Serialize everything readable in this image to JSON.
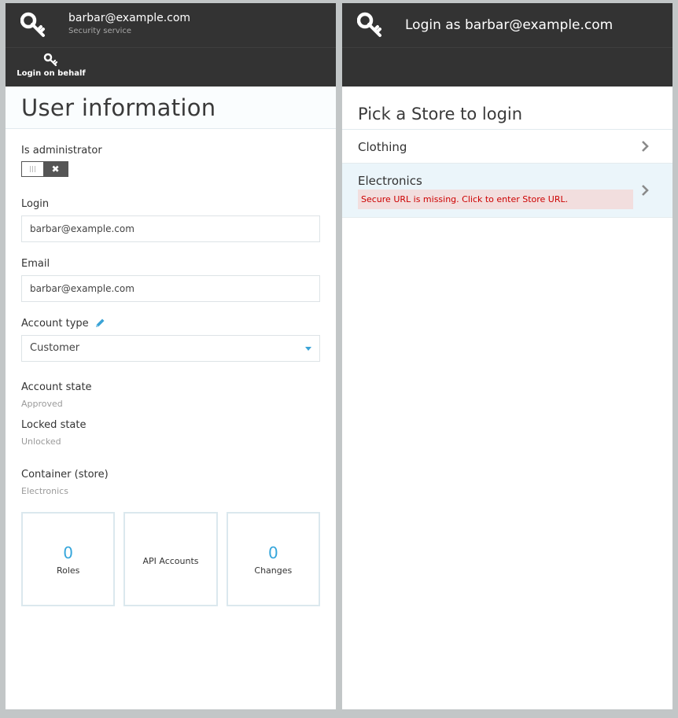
{
  "left_blade": {
    "header": {
      "title": "barbar@example.com",
      "subtitle": "Security service",
      "icon": "key-icon"
    },
    "toolbar": {
      "login_on_behalf": "Login on behalf",
      "icon": "key-icon"
    },
    "title": "User information",
    "is_admin": {
      "label": "Is administrator",
      "value": false
    },
    "login": {
      "label": "Login",
      "value": "barbar@example.com"
    },
    "email": {
      "label": "Email",
      "value": "barbar@example.com"
    },
    "account_type": {
      "label": "Account type",
      "value": "Customer",
      "edit_icon": "pencil-icon"
    },
    "account_state": {
      "label": "Account state",
      "value": "Approved"
    },
    "locked_state": {
      "label": "Locked state",
      "value": "Unlocked"
    },
    "container": {
      "label": "Container (store)",
      "value": "Electronics"
    },
    "tiles": [
      {
        "count": "0",
        "label": "Roles"
      },
      {
        "count": "",
        "label": "API Accounts"
      },
      {
        "count": "0",
        "label": "Changes"
      }
    ]
  },
  "right_blade": {
    "header": {
      "title": "Login as barbar@example.com",
      "icon": "key-icon"
    },
    "title": "Pick a Store to login",
    "stores": [
      {
        "name": "Clothing",
        "error": ""
      },
      {
        "name": "Electronics",
        "error": "Secure URL is missing. Click to enter Store URL."
      }
    ]
  },
  "colors": {
    "header_bg": "#333333",
    "accent": "#36a6db",
    "error_bg": "#f2dede",
    "error_text": "#cc0000",
    "active_row": "#ebf5fa"
  }
}
